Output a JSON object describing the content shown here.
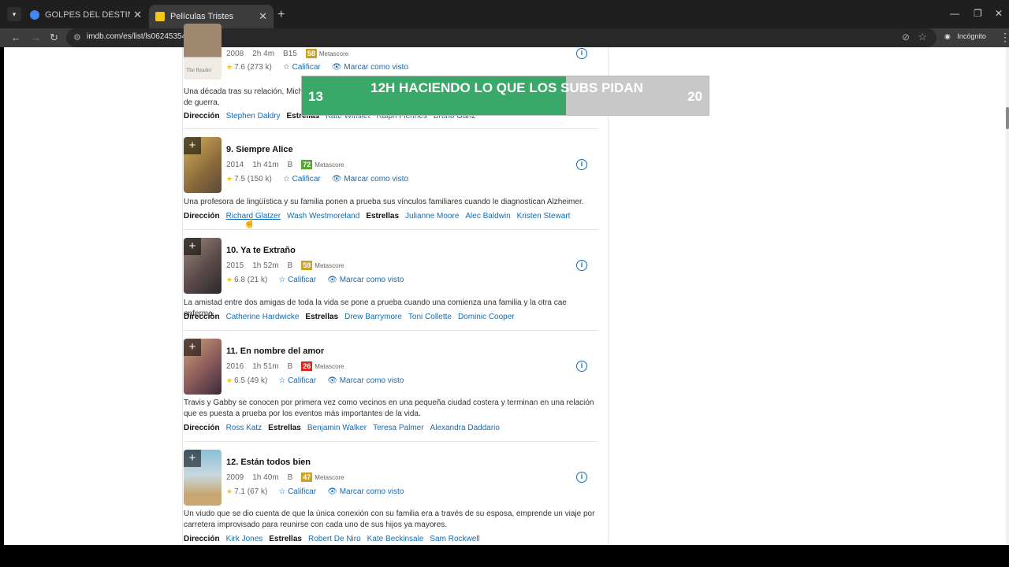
{
  "browser": {
    "tabs": [
      {
        "title": "GOLPES DEL DESTINO - Buscar",
        "active": false,
        "favicon_color": "#4285f4"
      },
      {
        "title": "Películas Tristes",
        "active": true,
        "favicon_color": "#f5c518"
      }
    ],
    "url": "imdb.com/es/list/ls062453547/",
    "incognito_label": "Incógnito"
  },
  "labels": {
    "metascore": "Metascore",
    "rate": "Calificar",
    "mark_seen": "Marcar como visto",
    "direction": "Dirección",
    "stars": "Estrellas"
  },
  "partial_item": {
    "year": "2008",
    "runtime": "2h 4m",
    "cert": "B15",
    "metascore": "58",
    "metascore_color": "#c9a227",
    "rating": "7.6",
    "votes": "(273 k)",
    "poster_caption": "The Reader",
    "desc_start": "Una década tras su relación, Mich",
    "desc_end_fragment": "...ones",
    "desc_line2": "de guerra.",
    "director": "Stephen Daldry",
    "stars_visible": [
      "Kate Winslet",
      "Ralph Fiennes",
      "Bruno Ganz"
    ]
  },
  "items": [
    {
      "title": "9. Siempre Alice",
      "year": "2014",
      "runtime": "1h 41m",
      "cert": "B",
      "metascore": "72",
      "metascore_color": "#54a72a",
      "rating": "7.5",
      "votes": "(150 k)",
      "desc": "Una profesora de lingüística y su familia ponen a prueba sus vínculos familiares cuando le diagnostican Alzheimer.",
      "directors": [
        "Richard Glatzer",
        "Wash Westmoreland"
      ],
      "stars": [
        "Julianne Moore",
        "Alec Baldwin",
        "Kristen Stewart"
      ],
      "poster_colors": [
        "#c9a24a",
        "#6a4a2a"
      ]
    },
    {
      "title": "10. Ya te Extraño",
      "year": "2015",
      "runtime": "1h 52m",
      "cert": "B",
      "metascore": "59",
      "metascore_color": "#c9a227",
      "rating": "6.8",
      "votes": "(21 k)",
      "desc": "La amistad entre dos amigas de toda la vida se pone a prueba cuando una comienza una familia y la otra cae enferma.",
      "directors": [
        "Catherine Hardwicke"
      ],
      "stars": [
        "Drew Barrymore",
        "Toni Collette",
        "Dominic Cooper"
      ],
      "poster_colors": [
        "#8a7a6a",
        "#3a3a3a"
      ]
    },
    {
      "title": "11. En nombre del amor",
      "year": "2016",
      "runtime": "1h 51m",
      "cert": "B",
      "metascore": "26",
      "metascore_color": "#e0251b",
      "rating": "6.5",
      "votes": "(49 k)",
      "desc": "Travis y Gabby se conocen por primera vez como vecinos en una pequeña ciudad costera y terminan en una relación que es puesta a prueba por los eventos más importantes de la vida.",
      "directors": [
        "Ross Katz"
      ],
      "stars": [
        "Benjamin Walker",
        "Teresa Palmer",
        "Alexandra Daddario"
      ],
      "poster_colors": [
        "#c08a6a",
        "#5a3a4a"
      ]
    },
    {
      "title": "12. Están todos bien",
      "year": "2009",
      "runtime": "1h 40m",
      "cert": "B",
      "metascore": "47",
      "metascore_color": "#c9a227",
      "rating": "7.1",
      "votes": "(67 k)",
      "desc": "Un viudo que se dio cuenta de que la única conexión con su familia era a través de su esposa, emprende un viaje por carretera improvisado para reunirse con cada uno de sus hijos ya mayores.",
      "directors": [
        "Kirk Jones"
      ],
      "stars": [
        "Robert De Niro",
        "Kate Beckinsale",
        "Sam Rockwell"
      ],
      "poster_colors": [
        "#7ab0c8",
        "#c8b080"
      ]
    }
  ],
  "stream_overlay": {
    "goal_text": "12H HACIENDO LO QUE LOS SUBS PIDAN",
    "current": "13",
    "target": "20",
    "progress_fraction": 0.65,
    "fill_color": "#3aa868"
  }
}
